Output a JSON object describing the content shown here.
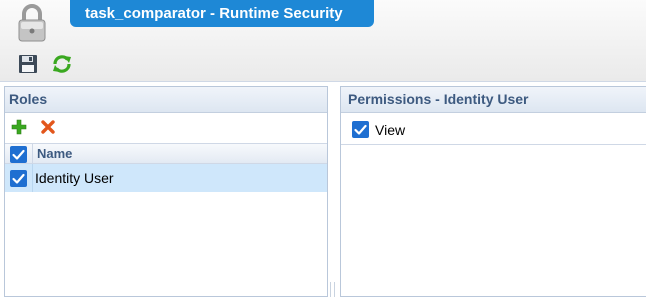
{
  "window": {
    "title": "task_comparator - Runtime Security"
  },
  "toolbar": {
    "items": [
      {
        "name": "save",
        "icon": "floppy-disk-icon"
      },
      {
        "name": "refresh",
        "icon": "refresh-icon"
      }
    ]
  },
  "roles": {
    "title": "Roles",
    "actions": [
      {
        "name": "add",
        "icon": "plus-icon",
        "color": "#3aa820"
      },
      {
        "name": "delete",
        "icon": "x-icon",
        "color": "#e2561c"
      }
    ],
    "columns": [
      "Name"
    ],
    "select_all_checked": true,
    "rows": [
      {
        "name": "Identity User",
        "checked": true,
        "selected": true
      }
    ]
  },
  "permissions": {
    "title": "Permissions - Identity User",
    "items": [
      {
        "label": "View",
        "checked": true
      }
    ]
  },
  "colors": {
    "accent": "#1e88d6",
    "checkbox": "#1f6fd1",
    "selected_row": "#cfe7fb",
    "panel_title_text": "#3d5a80"
  }
}
